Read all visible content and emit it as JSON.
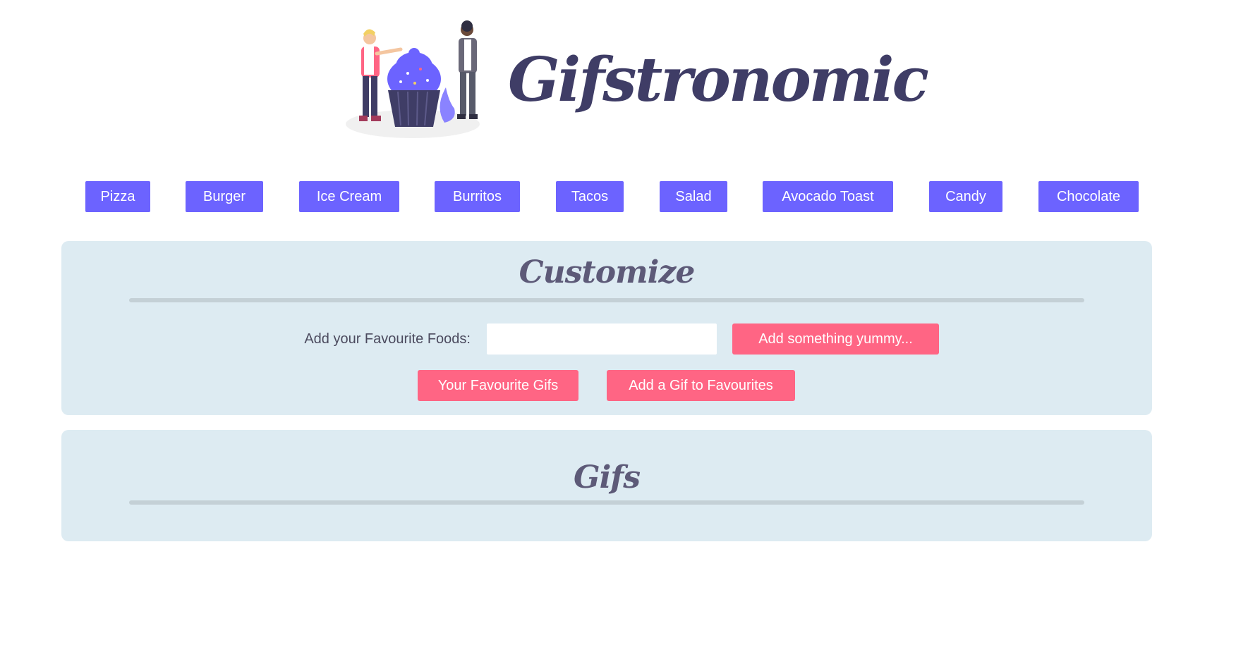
{
  "header": {
    "title": "Gifstronomic",
    "logo": "people-with-cupcake-illustration",
    "brand_color": "#3f3d66"
  },
  "food_buttons": [
    {
      "label": "Pizza"
    },
    {
      "label": "Burger"
    },
    {
      "label": "Ice Cream"
    },
    {
      "label": "Burritos"
    },
    {
      "label": "Tacos"
    },
    {
      "label": "Salad"
    },
    {
      "label": "Avocado Toast"
    },
    {
      "label": "Candy"
    },
    {
      "label": "Chocolate"
    }
  ],
  "customize": {
    "title": "Customize",
    "label": "Add your Favourite Foods:",
    "input_value": "",
    "input_placeholder": "",
    "add_button": "Add something yummy...",
    "favourites_button": "Your Favourite Gifs",
    "add_gif_button": "Add a Gif to Favourites"
  },
  "gifs": {
    "title": "Gifs"
  },
  "colors": {
    "accent_purple": "#6c63ff",
    "accent_pink": "#ff6584",
    "panel_bg": "#ddebf2",
    "panel_title": "#5d5a78"
  }
}
